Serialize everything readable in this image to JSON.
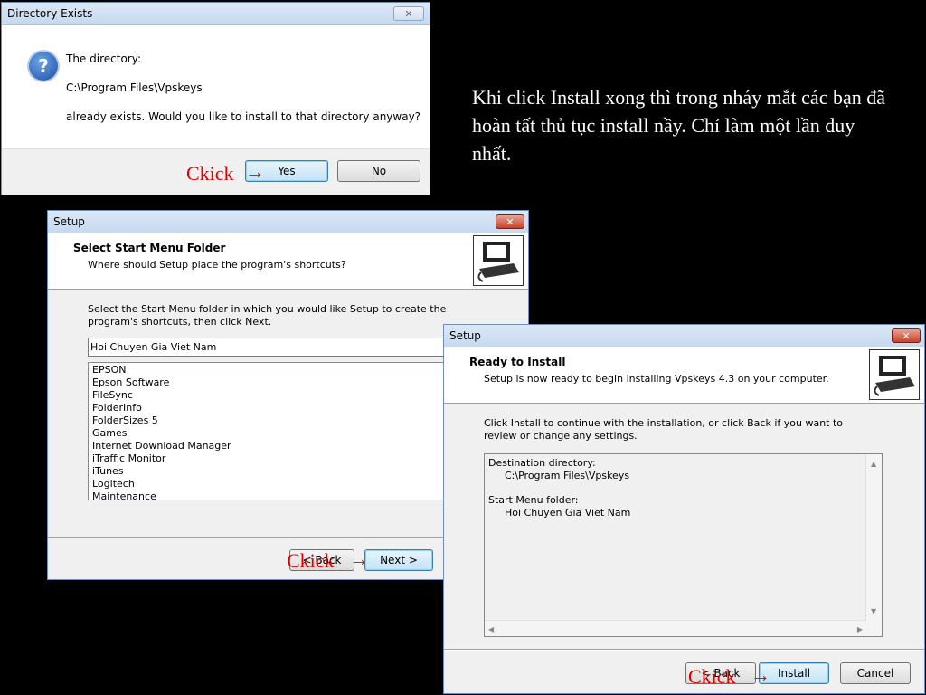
{
  "caption": "Khi click Install xong thì trong nháy mắt các bạn đã hoàn tất thủ tục install nầy. Chỉ làm một lần duy nhất.",
  "annotation_label": "Ckick",
  "arrow_glyph": "→",
  "dir_dialog": {
    "title": "Directory Exists",
    "close": "✕",
    "line1": "The directory:",
    "line2": "C:\\Program Files\\Vpskeys",
    "line3": "already exists. Would you like to install to that directory anyway?",
    "yes": "Yes",
    "no": "No",
    "question_glyph": "?"
  },
  "setup1": {
    "title": "Setup",
    "close": "✕",
    "heading": "Select Start Menu Folder",
    "subheading": "Where should Setup place the program's shortcuts?",
    "instruction": "Select the Start Menu folder in which you would like Setup to create the program's shortcuts, then click Next.",
    "folder_value": "Hoi Chuyen Gia Viet Nam",
    "folders": [
      "EPSON",
      "Epson Software",
      "FileSync",
      "FolderInfo",
      "FolderSizes 5",
      "Games",
      "Internet Download Manager",
      "iTraffic Monitor",
      "iTunes",
      "Logitech",
      "Maintenance"
    ],
    "back": "< Back",
    "next": "Next >"
  },
  "setup2": {
    "title": "Setup",
    "close": "✕",
    "heading": "Ready to Install",
    "subheading": "Setup is now ready to begin installing Vpskeys 4.3 on your computer.",
    "instruction": "Click Install to continue with the installation, or click Back if you want to review or change any settings.",
    "dest_label": "Destination directory:",
    "dest_value": "C:\\Program Files\\Vpskeys",
    "menu_label": "Start Menu folder:",
    "menu_value": "Hoi Chuyen Gia Viet Nam",
    "back": "< Back",
    "install": "Install",
    "cancel": "Cancel"
  },
  "colors": {
    "annotation": "#e00000",
    "title_blue": "#c6d9ef",
    "close_red": "#c7412a"
  }
}
